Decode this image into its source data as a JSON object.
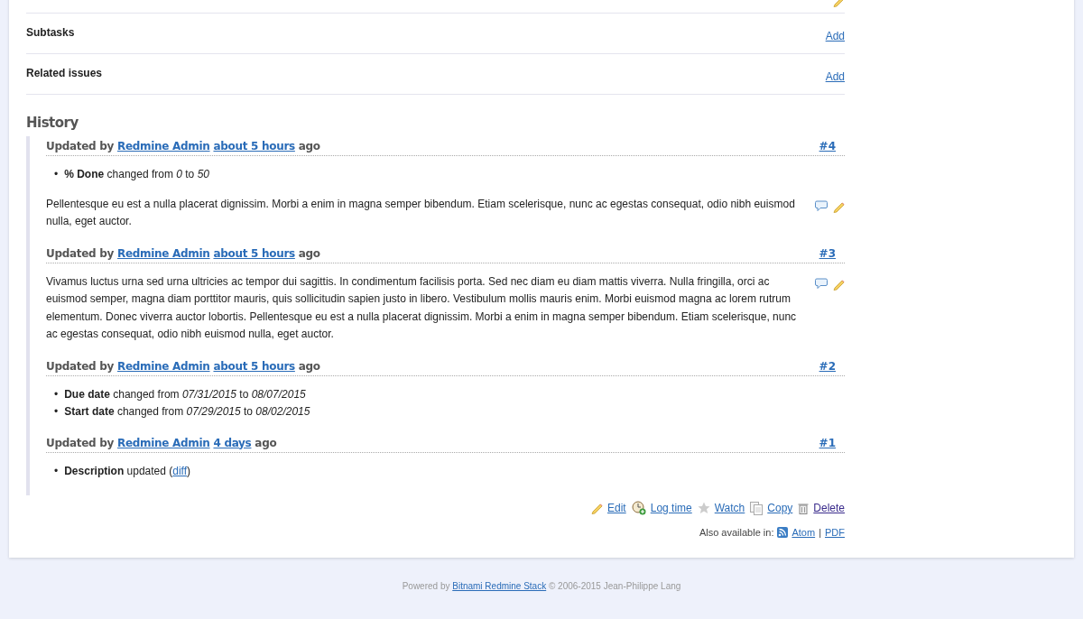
{
  "sections": [
    {
      "title": "Subtasks",
      "action": "Add"
    },
    {
      "title": "Related issues",
      "action": "Add"
    }
  ],
  "history": {
    "title": "History",
    "bullet": "•",
    "journals": [
      {
        "prefix": "Updated by",
        "author": "Redmine Admin",
        "time": "about 5 hours",
        "suffix": "ago",
        "number": "#4",
        "details": [
          {
            "kind": "change",
            "field": "% Done",
            "verb": "changed from",
            "old": "0",
            "joiner": "to",
            "new": "50"
          }
        ],
        "notes": "Pellentesque eu est a nulla placerat dignissim. Morbi a enim in magna semper bibendum. Etiam scelerisque, nunc ac egestas consequat, odio nibh euismod nulla, eget auctor."
      },
      {
        "prefix": "Updated by",
        "author": "Redmine Admin",
        "time": "about 5 hours",
        "suffix": "ago",
        "number": "#3",
        "notes": "Vivamus luctus urna sed urna ultricies ac tempor dui sagittis. In condimentum facilisis porta. Sed nec diam eu diam mattis viverra. Nulla fringilla, orci ac euismod semper, magna diam porttitor mauris, quis sollicitudin sapien justo in libero. Vestibulum mollis mauris enim. Morbi euismod magna ac lorem rutrum elementum. Donec viverra auctor lobortis. Pellentesque eu est a nulla placerat dignissim. Morbi a enim in magna semper bibendum. Etiam scelerisque, nunc ac egestas consequat, odio nibh euismod nulla, eget auctor."
      },
      {
        "prefix": "Updated by",
        "author": "Redmine Admin",
        "time": "about 5 hours",
        "suffix": "ago",
        "number": "#2",
        "details": [
          {
            "kind": "change",
            "field": "Due date",
            "verb": "changed from",
            "old": "07/31/2015",
            "joiner": "to",
            "new": "08/07/2015"
          },
          {
            "kind": "change",
            "field": "Start date",
            "verb": "changed from",
            "old": "07/29/2015",
            "joiner": "to",
            "new": "08/02/2015"
          }
        ]
      },
      {
        "prefix": "Updated by",
        "author": "Redmine Admin",
        "time": "4 days",
        "suffix": "ago",
        "number": "#1",
        "details": [
          {
            "kind": "link",
            "field": "Description",
            "verb": "updated (",
            "link": "diff",
            "close": ")"
          }
        ]
      }
    ]
  },
  "actions": [
    {
      "kind": "edit",
      "label": "Edit",
      "visited": false
    },
    {
      "kind": "log-time",
      "label": "Log time",
      "visited": false
    },
    {
      "kind": "watch",
      "label": "Watch",
      "visited": false
    },
    {
      "kind": "copy",
      "label": "Copy",
      "visited": false
    },
    {
      "kind": "delete",
      "label": "Delete",
      "visited": true
    }
  ],
  "formats": {
    "label": "Also available in:",
    "links": [
      {
        "kind": "atom",
        "label": "Atom"
      },
      {
        "kind": "pdf",
        "label": "PDF"
      }
    ],
    "separator": "|"
  },
  "footer": {
    "prefix": "Powered by",
    "link": "Bitnami Redmine Stack",
    "suffix": "© 2006-2015 Jean-Philippe Lang"
  }
}
